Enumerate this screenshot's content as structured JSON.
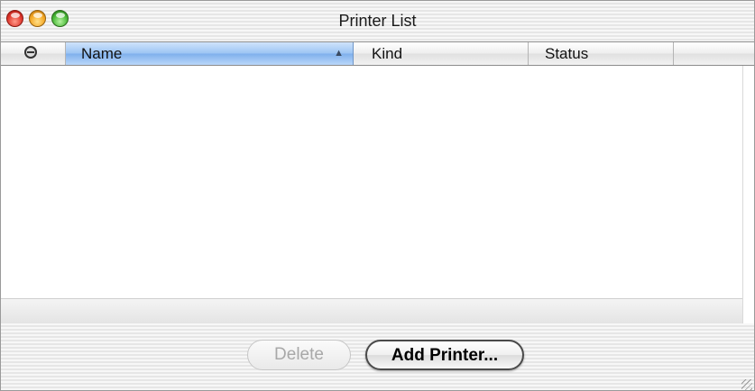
{
  "window": {
    "title": "Printer List"
  },
  "list": {
    "columns": [
      {
        "label": "",
        "icon": "printer-status-icon"
      },
      {
        "label": "Name",
        "sorted": true,
        "sort_direction": "ascending"
      },
      {
        "label": "Kind"
      },
      {
        "label": "Status"
      }
    ],
    "rows": []
  },
  "buttons": {
    "delete": "Delete",
    "add": "Add Printer..."
  },
  "colors": {
    "selected_column": "#9cc4f3",
    "close": "#e0372c",
    "minimize": "#f4a724",
    "zoom": "#49b938"
  }
}
